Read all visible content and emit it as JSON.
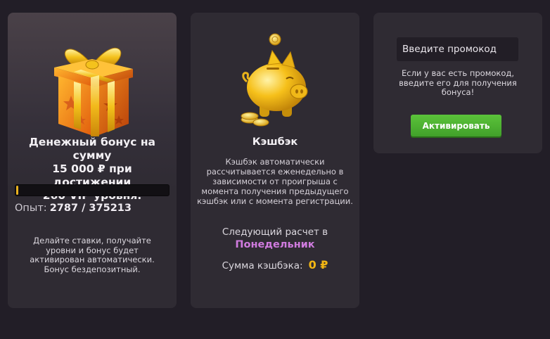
{
  "bonus": {
    "title_line1": "Денежный бонус на сумму",
    "title_line2": "15 000 ₽ при достижении",
    "title_line3": "260 VIP уровня.",
    "exp_label": "Опыт:",
    "exp_value": "2787 / 375213",
    "progress": 0.0074,
    "description": "Делайте ставки, получайте уровни и бонус будет активирован автоматически. Бонус бездепозитный."
  },
  "cashback": {
    "title": "Кэшбэк",
    "description": "Кэшбэк автоматически рассчитывается еженедельно в зависимости от проигрыша с момента получения предыдущего кэшбэк или с момента регистрации.",
    "next_label": "Следующий расчет в",
    "next_day": "Понедельник",
    "sum_label": "Сумма кэшбэка:",
    "sum_value": "0 ₽"
  },
  "promo": {
    "placeholder": "Введите промокод",
    "hint": "Если у вас есть промокод, введите его для получения бонуса!",
    "button_label": "Активировать"
  },
  "colors": {
    "page_bg": "#221e27",
    "card_bg": "#2f2b33",
    "accent_gold": "#f2b614",
    "accent_purple": "#d07bdf",
    "button_green": "#4cb032"
  }
}
